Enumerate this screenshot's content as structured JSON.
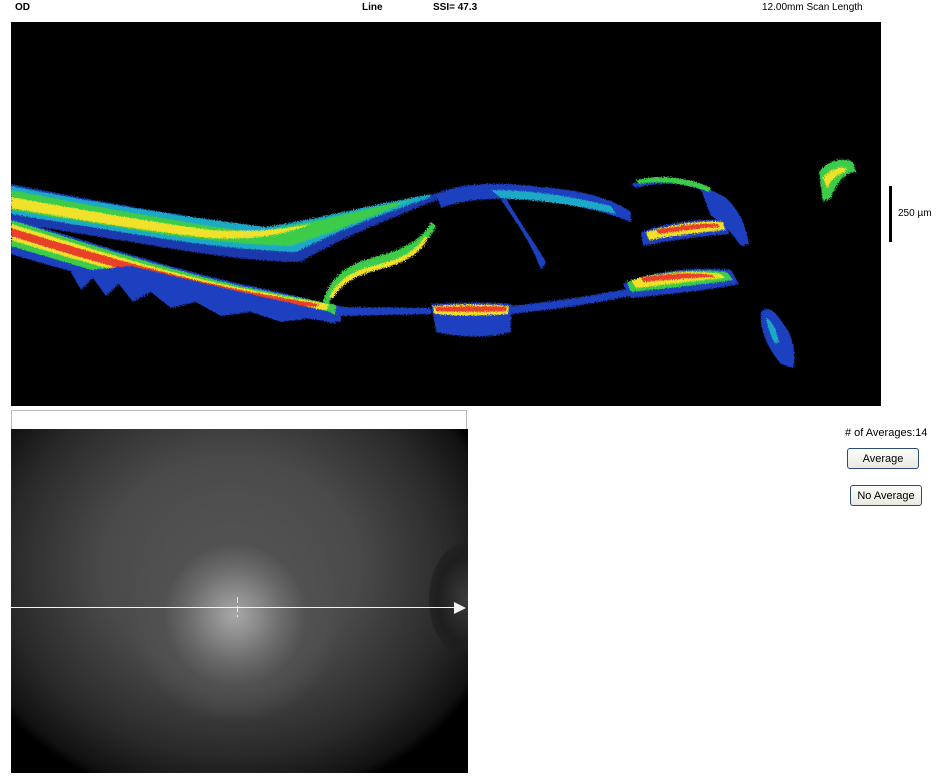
{
  "header": {
    "eye": "OD",
    "scan_type": "Line",
    "ssi": "SSI= 47.3",
    "scan_length": "12.00mm Scan Length"
  },
  "oct_scan": {
    "scale_label": "250 µm"
  },
  "averaging": {
    "count_label": "# of Averages:14",
    "average_button": "Average",
    "no_average_button": "No Average"
  },
  "colors": {
    "oct_background": "#000000",
    "layer_red": "#e8402a",
    "layer_yellow": "#f2e12b",
    "layer_green": "#3ccc4a",
    "layer_cyan": "#1fa9c6",
    "layer_blue": "#1c3fbf"
  }
}
